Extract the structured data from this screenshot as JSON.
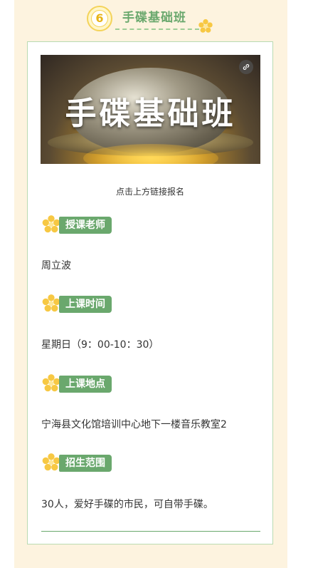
{
  "header": {
    "number": "6",
    "title": "手碟基础班"
  },
  "banner": {
    "title": "手碟基础班"
  },
  "caption": "点击上方链接报名",
  "sections": [
    {
      "label": "授课老师",
      "text": "周立波"
    },
    {
      "label": "上课时间",
      "text": "星期日（9：00-10：30）"
    },
    {
      "label": "上课地点",
      "text": "宁海县文化馆培训中心地下一楼音乐教室2"
    },
    {
      "label": "招生范围",
      "text": "30人，爱好手碟的市民，可自带手碟。"
    }
  ],
  "colors": {
    "accent_green": "#6aa86d",
    "flower_yellow": "#f7c843",
    "panel_bg": "#fdf3df"
  },
  "icons": {
    "header_badge": "number-circle-icon",
    "decoration": "flower-icon",
    "banner_link": "link-icon"
  }
}
